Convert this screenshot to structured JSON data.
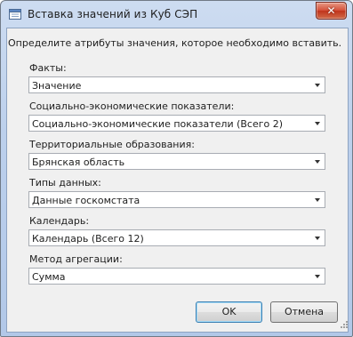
{
  "window": {
    "title": "Вставка значений из Куб СЭП",
    "close_glyph": "✕",
    "close_color": "#c8432a"
  },
  "instruction": "Определите атрибуты значения, которое необходимо вставить.",
  "fields": [
    {
      "label": "Факты:",
      "value": "Значение"
    },
    {
      "label": "Социально-экономические показатели:",
      "value": "Социально-экономические показатели (Всего 2)"
    },
    {
      "label": "Территориальные образования:",
      "value": "Брянская область"
    },
    {
      "label": "Типы данных:",
      "value": "Данные госкомстата"
    },
    {
      "label": "Календарь:",
      "value": "Календарь (Всего 12)"
    },
    {
      "label": "Метод агрегации:",
      "value": "Сумма"
    }
  ],
  "buttons": {
    "ok": "OK",
    "cancel": "Отмена"
  }
}
